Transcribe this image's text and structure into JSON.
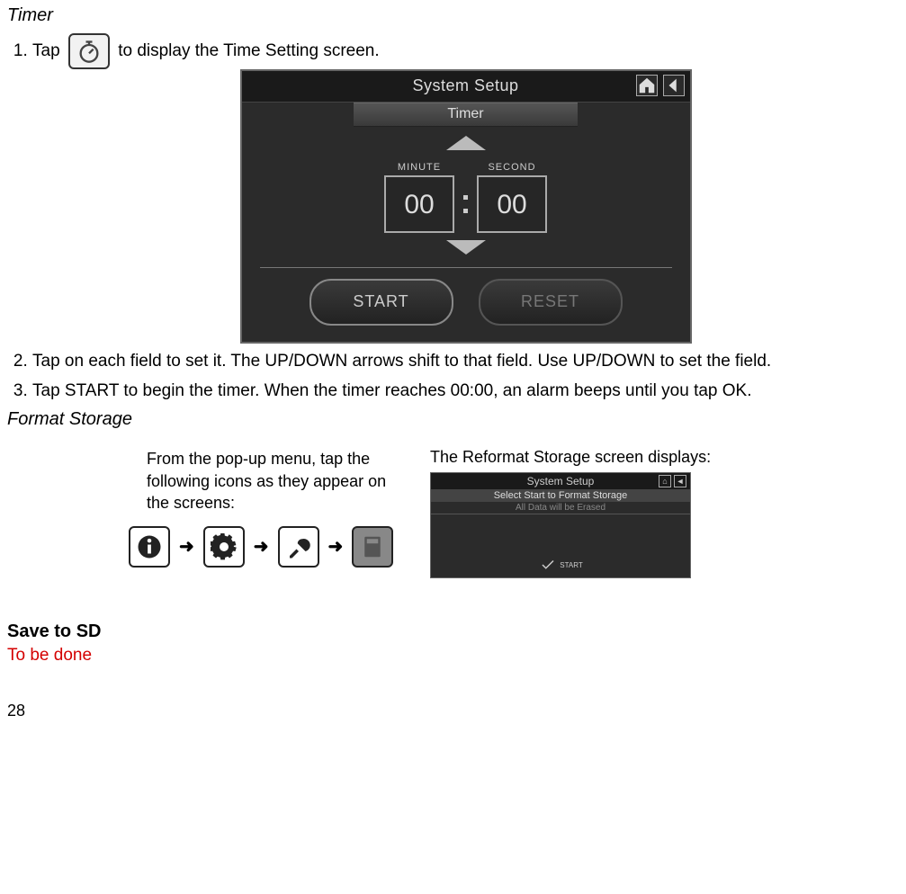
{
  "headings": {
    "timer": "Timer",
    "format_storage": "Format Storage",
    "save_to_sd": "Save to SD"
  },
  "steps": {
    "s1_prefix": "Tap",
    "s1_suffix": " to display the Time Setting screen.",
    "s2": "Tap on each field to set it. The UP/DOWN arrows shift to that field. Use UP/DOWN to set the field.",
    "s3": "Tap START to begin the timer. When the timer reaches 00:00, an alarm beeps until you tap OK."
  },
  "device_timer": {
    "title": "System Setup",
    "tab": "Timer",
    "minute_label": "MINUTE",
    "second_label": "SECOND",
    "minute_value": "00",
    "second_value": "00",
    "start_btn": "START",
    "reset_btn": "RESET"
  },
  "format_storage": {
    "left_text": "From the pop-up menu, tap the following icons as they appear on the screens:",
    "right_text": "The Reformat Storage screen displays:",
    "arrow": "➜"
  },
  "mini_device": {
    "title": "System Setup",
    "line1": "Select Start to Format Storage",
    "line2": "All Data will be Erased",
    "start": "START"
  },
  "tbd": "To be done",
  "page_number": "28"
}
